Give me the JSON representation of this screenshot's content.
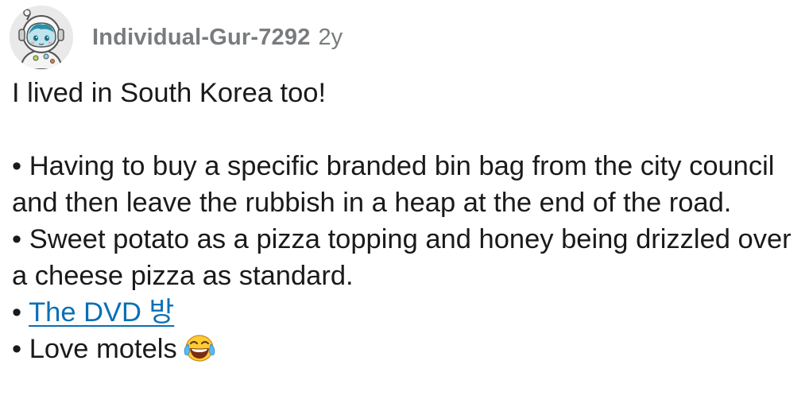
{
  "comment": {
    "author": "Individual-Gur-7292",
    "age": "2y",
    "intro": "I lived in South Korea too!",
    "bullet_char": "•",
    "bullets": [
      "Having to buy a specific branded bin bag from the city council and then leave the rubbish in a heap at the end of the road.",
      "Sweet potato as a pizza topping and honey being drizzled over a cheese pizza as standard.",
      "The DVD 방",
      "Love motels"
    ],
    "link_color": "#0a6fb5",
    "meta_color": "#787c7e",
    "avatar_icon": "astronaut-avatar-icon",
    "emoji_icon": "face-with-tears-of-joy-icon"
  }
}
